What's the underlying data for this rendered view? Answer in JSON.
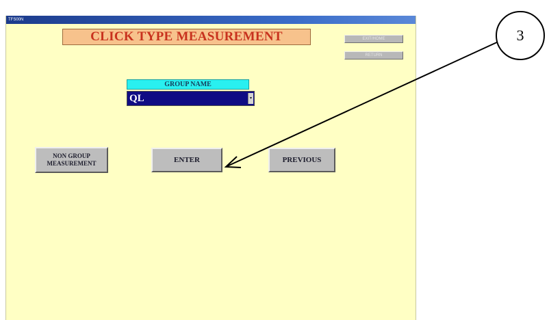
{
  "window": {
    "title": "TFS00N"
  },
  "header": {
    "title": "CLICK TYPE MEASUREMENT",
    "top_buttons": [
      "EXIT/HOME",
      "RETURN"
    ]
  },
  "group": {
    "label": "GROUP NAME",
    "selected_value": "QL",
    "arrow_icon": "▾"
  },
  "buttons": {
    "non_group": "NON GROUP MEASUREMENT",
    "enter": "ENTER",
    "previous": "PREVIOUS"
  },
  "annotation": {
    "callout_number": "3"
  },
  "colors": {
    "window_bg": "#ffffc4",
    "banner_bg": "#f7c28c",
    "banner_text": "#c8321e",
    "group_label_bg": "#29f0f0",
    "group_select_bg": "#100c84",
    "button_bg": "#bdbdbd"
  }
}
